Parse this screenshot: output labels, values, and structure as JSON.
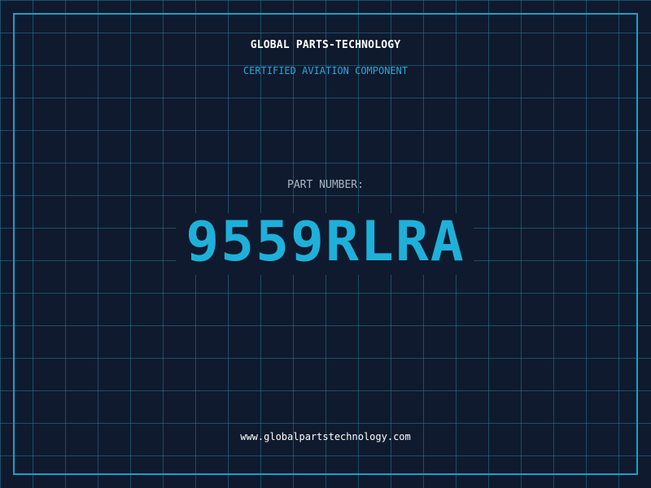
{
  "header": {
    "company": "GLOBAL PARTS-TECHNOLOGY",
    "tagline": "CERTIFIED AVIATION COMPONENT"
  },
  "part": {
    "label": "PART NUMBER:",
    "number": "9559RLRA"
  },
  "footer": {
    "url": "www.globalpartstechnology.com"
  },
  "colors": {
    "background": "#0f1a2e",
    "grid": "#26789a",
    "accent": "#1fb0da",
    "frame": "#1a9fc9",
    "text": "#ffffff",
    "muted": "#a9b6c4"
  }
}
